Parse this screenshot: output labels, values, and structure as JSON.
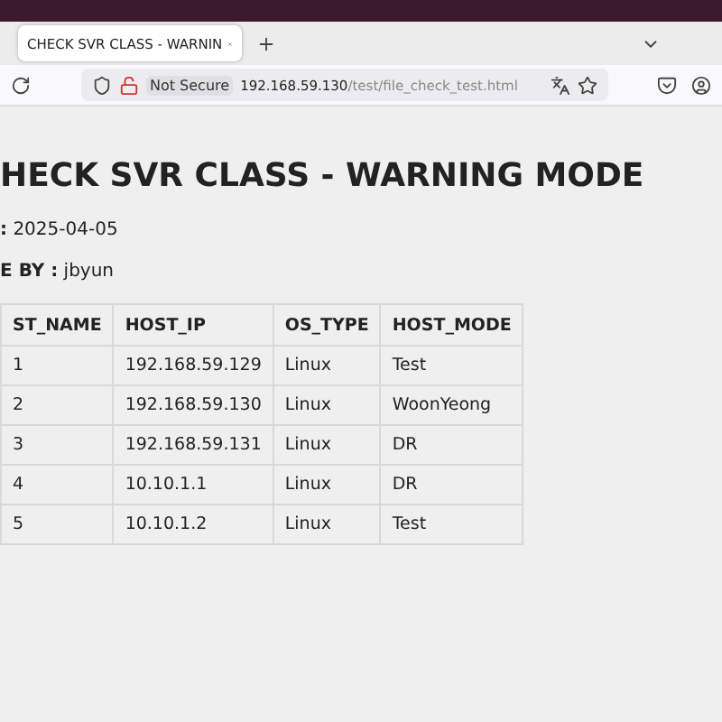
{
  "browser": {
    "tab": {
      "title": "CHECK SVR CLASS - WARNIN",
      "selected": true
    },
    "security": "Not Secure",
    "url_host": "192.168.59.130",
    "url_path": "/test/file_check_test.html"
  },
  "page": {
    "title": "HECK SVR CLASS - WARNING MODE",
    "meta": [
      {
        "label": ":",
        "value": "2025-04-05"
      },
      {
        "label": "E BY :",
        "value": "jbyun"
      }
    ],
    "table": {
      "columns": [
        "ST_NAME",
        "HOST_IP",
        "OS_TYPE",
        "HOST_MODE"
      ],
      "rows": [
        [
          "1",
          "192.168.59.129",
          "Linux",
          "Test"
        ],
        [
          "2",
          "192.168.59.130",
          "Linux",
          "WoonYeong"
        ],
        [
          "3",
          "192.168.59.131",
          "Linux",
          "DR"
        ],
        [
          "4",
          "10.10.1.1",
          "Linux",
          "DR"
        ],
        [
          "5",
          "10.10.1.2",
          "Linux",
          "Test"
        ]
      ]
    }
  }
}
